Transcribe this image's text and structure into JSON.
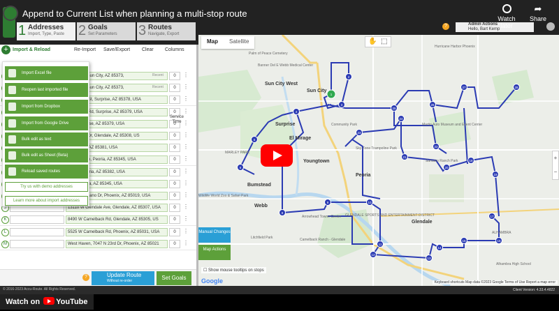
{
  "youtube": {
    "video_title": "Append to Current List when planning a multi-stop route",
    "watch_later_label": "Watch later",
    "share_label": "Share",
    "watch_on_label": "Watch on",
    "youtube_label": "YouTube"
  },
  "app": {
    "tabs": [
      {
        "num": "1",
        "label": "Addresses",
        "sub": "Import, Type, Paste"
      },
      {
        "num": "2",
        "label": "Goals",
        "sub": "Set Parameters"
      },
      {
        "num": "3",
        "label": "Routes",
        "sub": "Navigate, Export"
      }
    ],
    "admin_actions": "Admin Actions",
    "user_greeting": "Hello, Bart Kemp"
  },
  "toolbar": {
    "import_reload": "Import & Reload",
    "reimport": "Re-Import",
    "save_export": "Save/Export",
    "clear": "Clear",
    "columns": "Columns"
  },
  "import_menu": {
    "items": [
      "Import Excel file",
      "Reopen last imported file",
      "Import from Dropbox",
      "Import from Google Drive",
      "Bulk edit as text",
      "Bulk edit as Sheet (Beta)",
      "Reload saved routes"
    ],
    "try_demo": "Try us with demo addresses",
    "learn_more": "Learn more about import addresses"
  },
  "table": {
    "service_time_header": "Service Time",
    "recent_label": "Recent",
    "rows": [
      {
        "letter": "",
        "address": "rmosa Dr, Sun City, AZ 85373,",
        "service": "0",
        "recent": true
      },
      {
        "letter": "",
        "address": "rmosa Dr, Sun City, AZ 85373,",
        "service": "0",
        "recent": true
      },
      {
        "letter": "",
        "address": "easewood St, Surprise, AZ 85378, USA",
        "service": "0",
        "recent": false
      },
      {
        "letter": "",
        "address": "oca Raton Rd, Surprise, AZ 85379, USA",
        "service": "0",
        "recent": false
      },
      {
        "letter": "",
        "address": "d Dr, Surprise, AZ 85379, USA",
        "service": "0",
        "recent": false
      },
      {
        "letter": "",
        "address": "a Theresa Dr, Glendale, AZ 85308, US",
        "service": "0",
        "recent": false
      },
      {
        "letter": "",
        "address": "Dr, Peoria, AZ 85381, USA",
        "service": "0",
        "recent": false
      },
      {
        "letter": "",
        "address": "nnyslope Ln, Peoria, AZ 85345, USA",
        "service": "0",
        "recent": false
      },
      {
        "letter": "",
        "address": "th Ave, Peoria, AZ 85382, USA",
        "service": "0",
        "recent": false
      },
      {
        "letter": "",
        "address": "th Dr, Peoria, AZ 85345, USA",
        "service": "0",
        "recent": false
      },
      {
        "letter": "I",
        "address": "4001 W Solano Dr, Phoenix, AZ 85019, USA",
        "service": "0",
        "recent": false
      },
      {
        "letter": "J",
        "address": "13110 W Glendale Ave, Glendale, AZ 85307, USA",
        "service": "0",
        "recent": false
      },
      {
        "letter": "K",
        "address": "8490 W Camelback Rd, Glendale, AZ 85305, US",
        "service": "0",
        "recent": false
      },
      {
        "letter": "L",
        "address": "5525 W Camelback Rd, Phoenix, AZ 85031, USA",
        "service": "0",
        "recent": false
      },
      {
        "letter": "M",
        "address": "West Haven, 7047 N 23rd Dr, Phoenix, AZ 85021",
        "service": "0",
        "recent": false
      }
    ]
  },
  "bottom": {
    "update_route": "Update Route",
    "update_route_sub": "Without re-order",
    "set_goals": "Set Goals",
    "copyright": "© 2016-2023 Accu-Route. All Rights Reserved.",
    "client_version": "Client Version: 4.33.4.4822"
  },
  "map": {
    "tab_map": "Map",
    "tab_satellite": "Satellite",
    "manual_changes": "Manual Changes",
    "map_actions": "Map Actions",
    "tooltip_check": "Show mouse tooltips on stops",
    "footer": "Keyboard shortcuts   Map data ©2023 Google   Terms of Use   Report a map error",
    "google": "Google",
    "labels": [
      {
        "text": "Sun City West",
        "kind": "place"
      },
      {
        "text": "Sun City",
        "kind": "place"
      },
      {
        "text": "Surprise",
        "kind": "place"
      },
      {
        "text": "El Mirage",
        "kind": "place"
      },
      {
        "text": "Youngtown",
        "kind": "place"
      },
      {
        "text": "Peoria",
        "kind": "place"
      },
      {
        "text": "Glendale",
        "kind": "place"
      },
      {
        "text": "Bumstead",
        "kind": "place"
      },
      {
        "text": "Webb",
        "kind": "place"
      },
      {
        "text": "Banner Del E Webb Medical Center",
        "kind": "poi"
      },
      {
        "text": "Sky Zone Trampoline Park",
        "kind": "poi"
      },
      {
        "text": "Martin Auto Museum and Event Center",
        "kind": "poi"
      },
      {
        "text": "Camelback Ranch - Glendale",
        "kind": "poi"
      },
      {
        "text": "Wildlife World Zoo & Safari Park",
        "kind": "poi"
      },
      {
        "text": "Arrowhead Towne Center",
        "kind": "poi"
      },
      {
        "text": "Litchfield Park",
        "kind": "poi"
      },
      {
        "text": "Hurricane Harbor Phoenix",
        "kind": "poi"
      },
      {
        "text": "Sahuaro Ranch Park",
        "kind": "poi"
      },
      {
        "text": "Community Park",
        "kind": "poi"
      },
      {
        "text": "Alhambra High School",
        "kind": "poi"
      },
      {
        "text": "ALHAMBRA",
        "kind": "poi"
      },
      {
        "text": "Palm of Peace Cemetery",
        "kind": "poi"
      },
      {
        "text": "MARLEY PARK",
        "kind": "poi"
      },
      {
        "text": "GLENDALE SPORTS AND ENTERTAINMENT DISTRICT",
        "kind": "poi"
      }
    ],
    "stop_numbers": [
      "1",
      "2",
      "3",
      "4",
      "5",
      "6",
      "7",
      "8",
      "9",
      "10",
      "11",
      "12",
      "13",
      "14",
      "15",
      "16",
      "17",
      "18",
      "19",
      "20",
      "21",
      "22",
      "23",
      "24",
      "25",
      "26",
      "27",
      "28"
    ]
  }
}
